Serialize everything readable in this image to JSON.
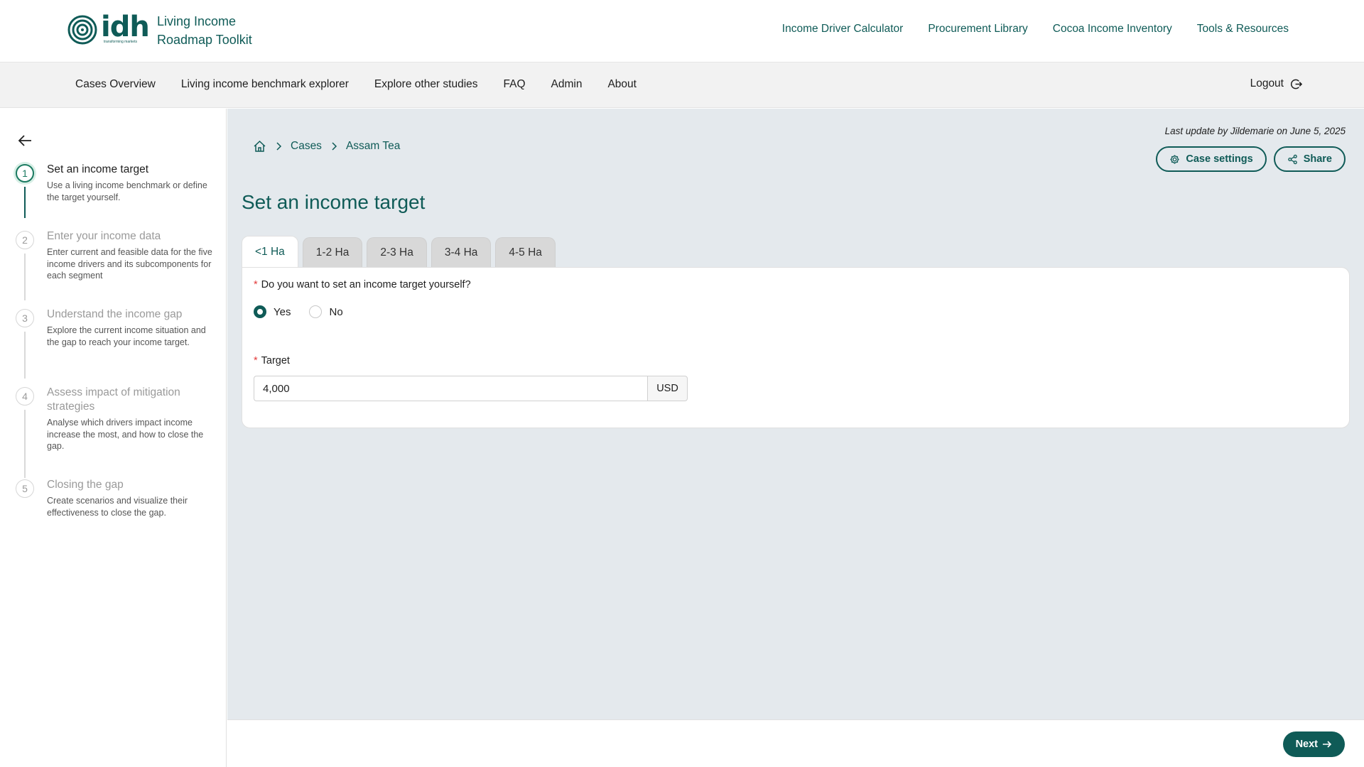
{
  "brand": {
    "logo_text": "idh",
    "logo_subtext": "transforming markets",
    "title_line1": "Living Income",
    "title_line2": "Roadmap Toolkit",
    "color": "#0f5b57"
  },
  "top_nav": [
    "Income Driver Calculator",
    "Procurement Library",
    "Cocoa Income Inventory",
    "Tools & Resources"
  ],
  "sub_nav": {
    "items": [
      "Cases Overview",
      "Living income benchmark explorer",
      "Explore other studies",
      "FAQ",
      "Admin",
      "About"
    ],
    "logout_label": "Logout"
  },
  "sidebar": {
    "steps": [
      {
        "num": "1",
        "title": "Set an income target",
        "desc": "Use a living income benchmark or define the target yourself.",
        "active": true
      },
      {
        "num": "2",
        "title": "Enter your income data",
        "desc": "Enter current and feasible data for the five income drivers and its subcomponents for each segment"
      },
      {
        "num": "3",
        "title": "Understand the income gap",
        "desc": "Explore the current income situation and the gap to reach your income target."
      },
      {
        "num": "4",
        "title": "Assess impact of mitigation strategies",
        "desc": "Analyse which drivers impact income increase the most, and how to close the gap."
      },
      {
        "num": "5",
        "title": "Closing the gap",
        "desc": "Create scenarios and visualize their effectiveness to close the gap."
      }
    ]
  },
  "breadcrumb": {
    "cases": "Cases",
    "current": "Assam Tea"
  },
  "last_update": "Last update by Jildemarie on June 5, 2025",
  "actions": {
    "case_settings": "Case settings",
    "share": "Share"
  },
  "page_title": "Set an income target",
  "tabs": [
    "<1 Ha",
    "1-2 Ha",
    "2-3 Ha",
    "3-4 Ha",
    "4-5 Ha"
  ],
  "form": {
    "question": "Do you want to set an income target yourself?",
    "options": {
      "yes": "Yes",
      "no": "No"
    },
    "selected": "Yes",
    "target_label": "Target",
    "target_value": "4,000",
    "currency": "USD"
  },
  "footer": {
    "next_label": "Next"
  }
}
